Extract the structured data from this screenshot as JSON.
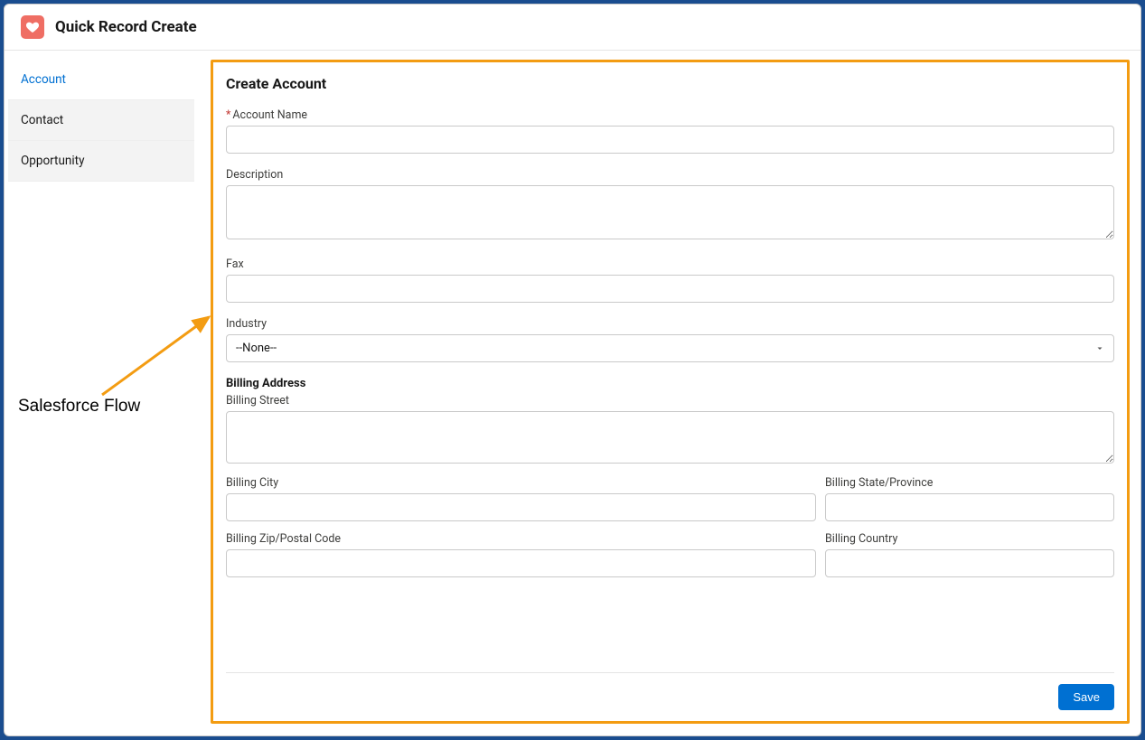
{
  "header": {
    "title": "Quick Record Create",
    "icon": "heart-icon"
  },
  "sidebar": {
    "items": [
      {
        "label": "Account",
        "active": true
      },
      {
        "label": "Contact",
        "active": false
      },
      {
        "label": "Opportunity",
        "active": false
      }
    ]
  },
  "form": {
    "title": "Create Account",
    "fields": {
      "account_name": {
        "label": "Account Name",
        "required": true,
        "value": ""
      },
      "description": {
        "label": "Description",
        "value": ""
      },
      "fax": {
        "label": "Fax",
        "value": ""
      },
      "industry": {
        "label": "Industry",
        "selected": "--None--"
      }
    },
    "billing_section": {
      "heading": "Billing Address",
      "street": {
        "label": "Billing Street",
        "value": ""
      },
      "city": {
        "label": "Billing City",
        "value": ""
      },
      "state": {
        "label": "Billing State/Province",
        "value": ""
      },
      "zip": {
        "label": "Billing Zip/Postal Code",
        "value": ""
      },
      "country": {
        "label": "Billing Country",
        "value": ""
      }
    },
    "save_label": "Save"
  },
  "annotation": {
    "text": "Salesforce Flow"
  },
  "colors": {
    "brand_accent": "#0070d2",
    "highlight_border": "#f39c12",
    "app_icon_bg": "#ef6e64"
  }
}
